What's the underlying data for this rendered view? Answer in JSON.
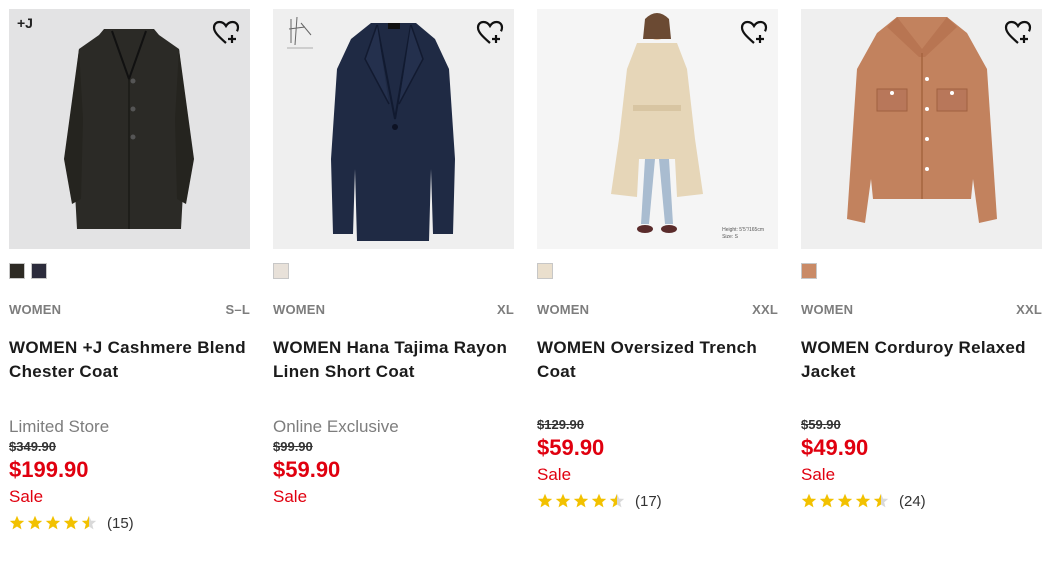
{
  "products": [
    {
      "badge": "+J",
      "swatches": [
        "#2d2a24",
        "#2c2c3c"
      ],
      "category": "WOMEN",
      "size": "S–L",
      "name": "WOMEN +J Cashmere Blend Chester Coat",
      "flag": "Limited Store",
      "original_price": "$349.90",
      "price": "$199.90",
      "sale_label": "Sale",
      "rating": 4.5,
      "review_count": "(15)"
    },
    {
      "swatches": [
        "#e8e1d9"
      ],
      "category": "WOMEN",
      "size": "XL",
      "name": "WOMEN Hana Tajima Rayon Linen Short Coat",
      "flag": "Online Exclusive",
      "original_price": "$99.90",
      "price": "$59.90",
      "sale_label": "Sale"
    },
    {
      "swatches": [
        "#eadfcd"
      ],
      "category": "WOMEN",
      "size": "XXL",
      "name": "WOMEN Oversized Trench Coat",
      "original_price": "$129.90",
      "price": "$59.90",
      "sale_label": "Sale",
      "rating": 4.5,
      "review_count": "(17)",
      "model_info": [
        "Height: 5'5\"/165cm",
        "Size: S"
      ]
    },
    {
      "swatches": [
        "#c98a66"
      ],
      "category": "WOMEN",
      "size": "XXL",
      "name": "WOMEN Corduroy Relaxed Jacket",
      "original_price": "$59.90",
      "price": "$49.90",
      "sale_label": "Sale",
      "rating": 4.5,
      "review_count": "(24)"
    }
  ],
  "colors": {
    "sale_red": "#e0000f",
    "star_gold": "#f2c100",
    "meta_grey": "#7d7d7d"
  },
  "icons": {
    "wishlist": "heart-plus-icon",
    "rating": "star-icon"
  }
}
